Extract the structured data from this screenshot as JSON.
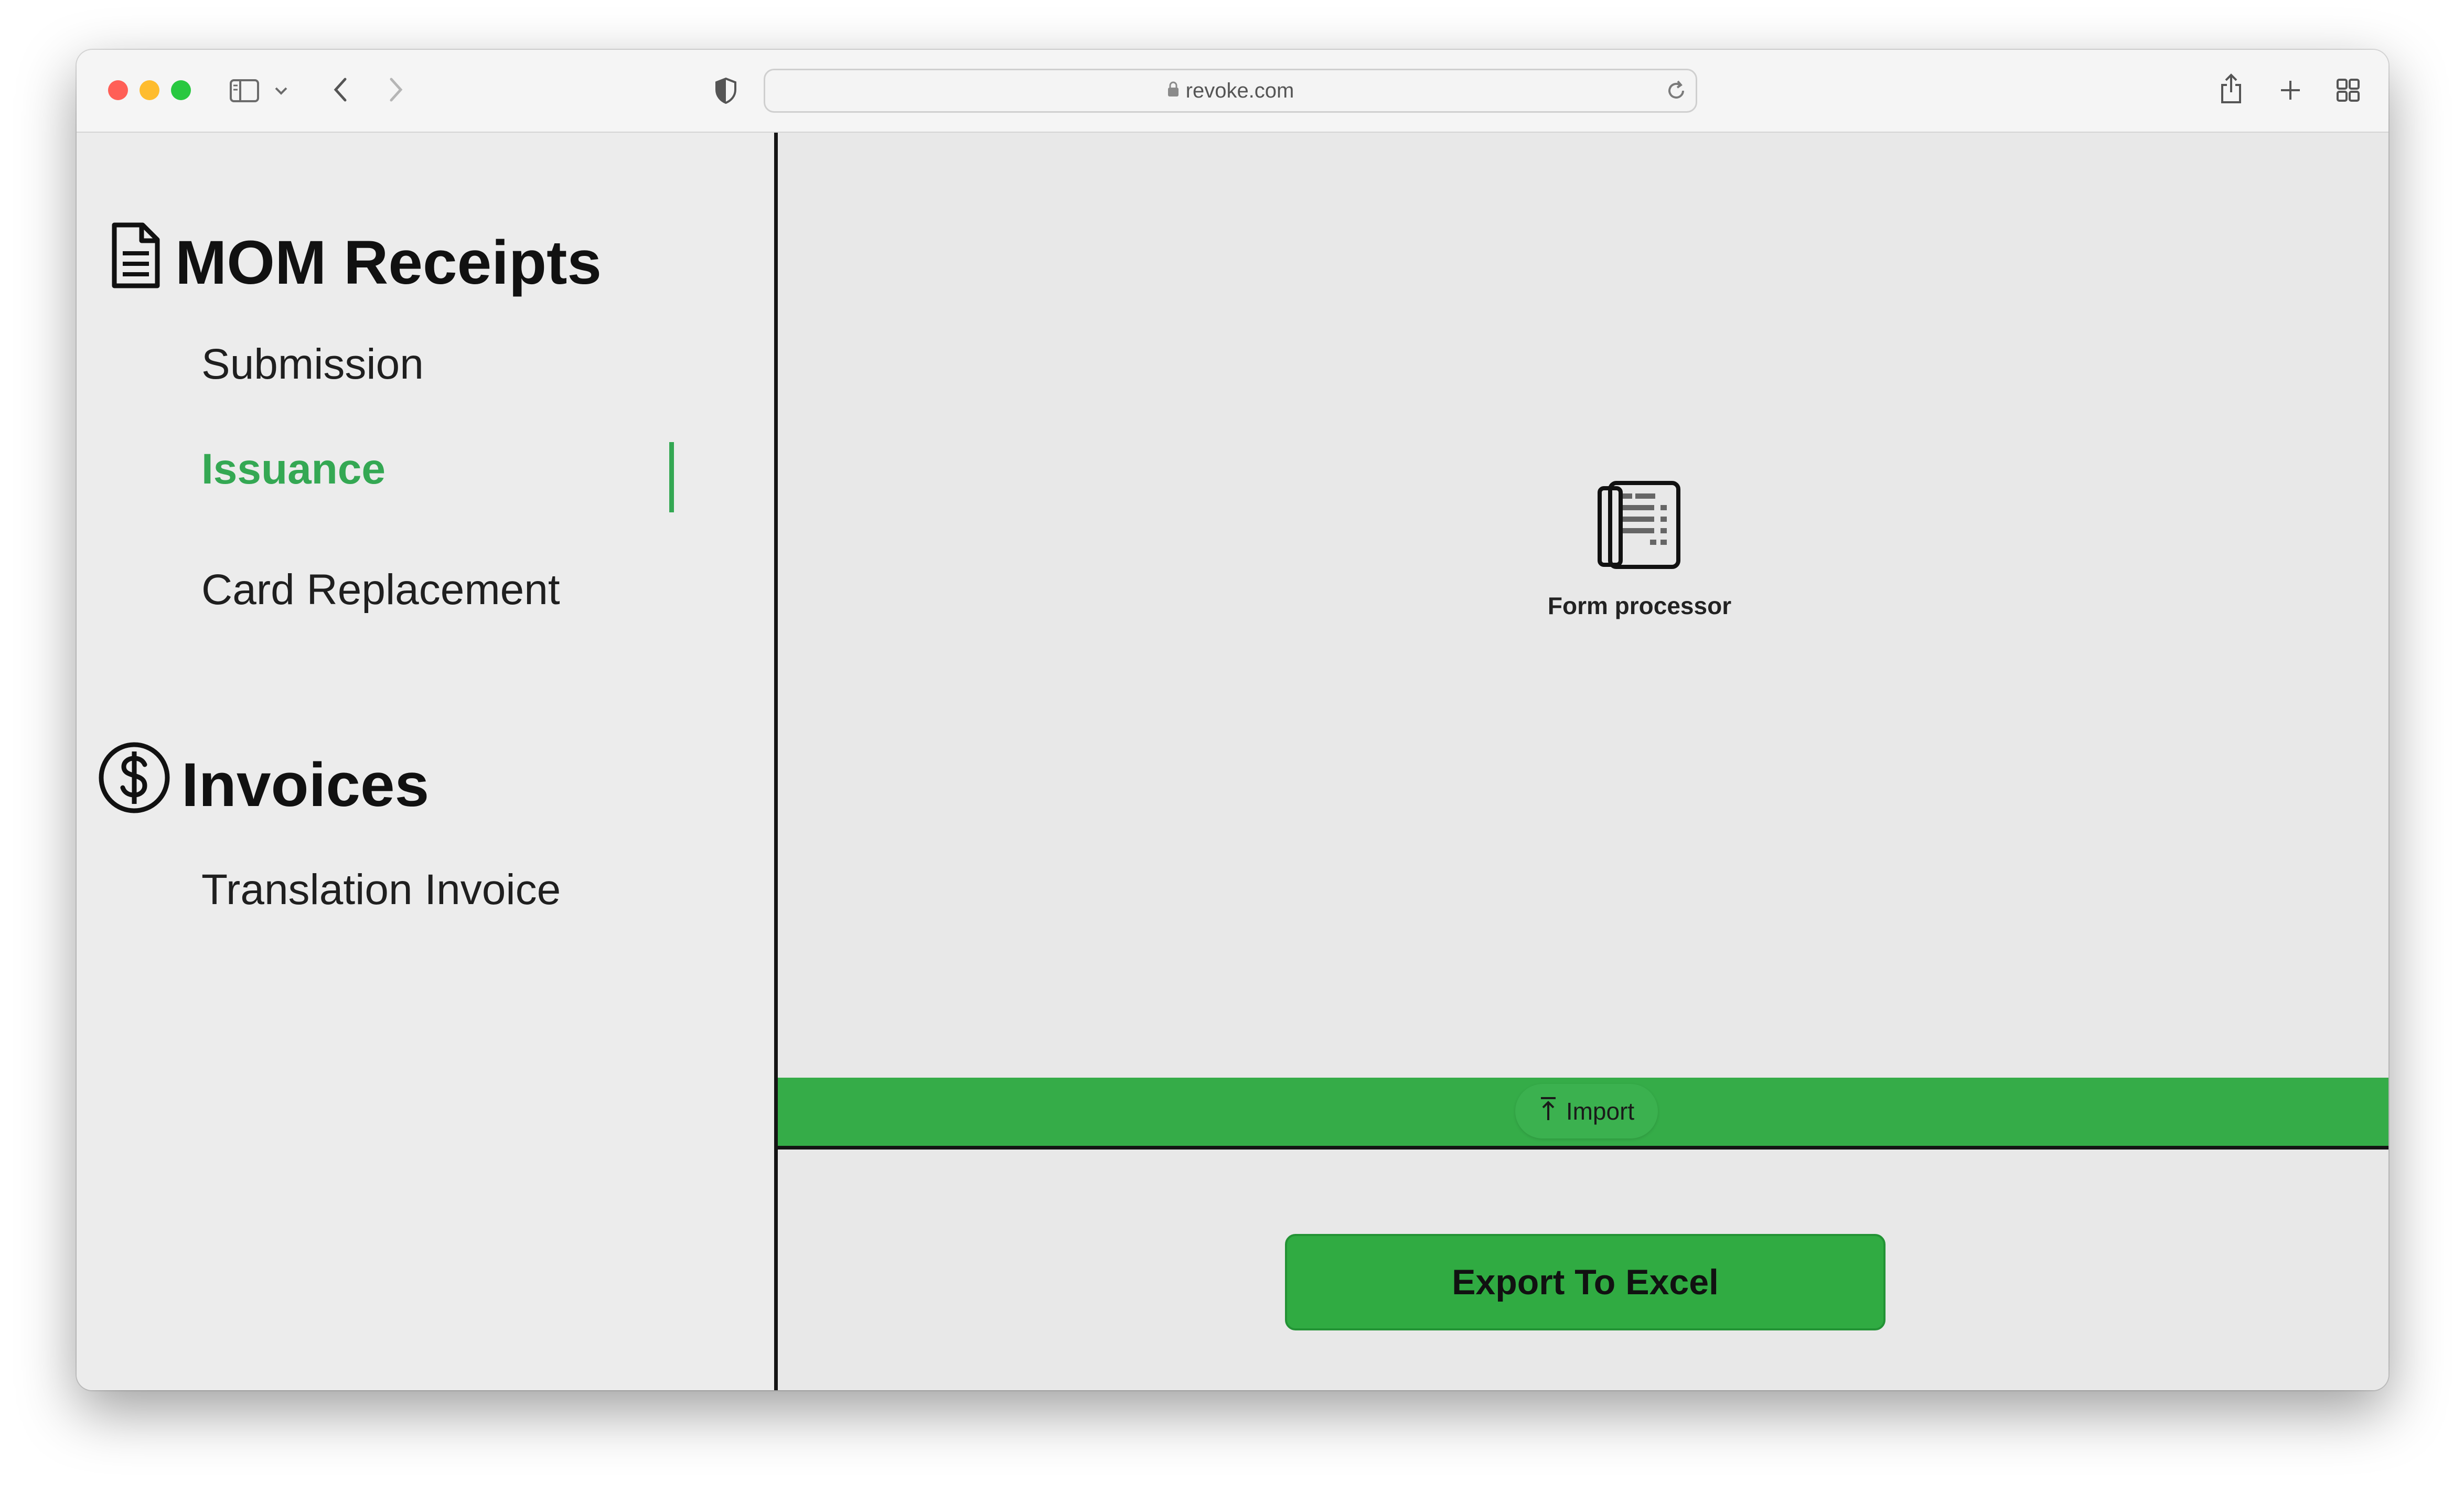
{
  "browser": {
    "url": "revoke.com"
  },
  "sidebar": {
    "sections": [
      {
        "title": "MOM Receipts",
        "icon": "document-icon",
        "items": [
          {
            "label": "Submission",
            "active": false
          },
          {
            "label": "Issuance",
            "active": true
          },
          {
            "label": "Card Replacement",
            "active": false
          }
        ]
      },
      {
        "title": "Invoices",
        "icon": "dollar-circle-icon",
        "items": [
          {
            "label": "Translation Invoice",
            "active": false
          }
        ]
      }
    ]
  },
  "main": {
    "form_processor": {
      "label": "Form processor",
      "icon": "form-processor-icon"
    },
    "import_label": "Import",
    "export_label": "Export To Excel"
  },
  "colors": {
    "accent_green": "#34a853",
    "button_green": "#30ab42",
    "bar_green": "#35ac48"
  }
}
